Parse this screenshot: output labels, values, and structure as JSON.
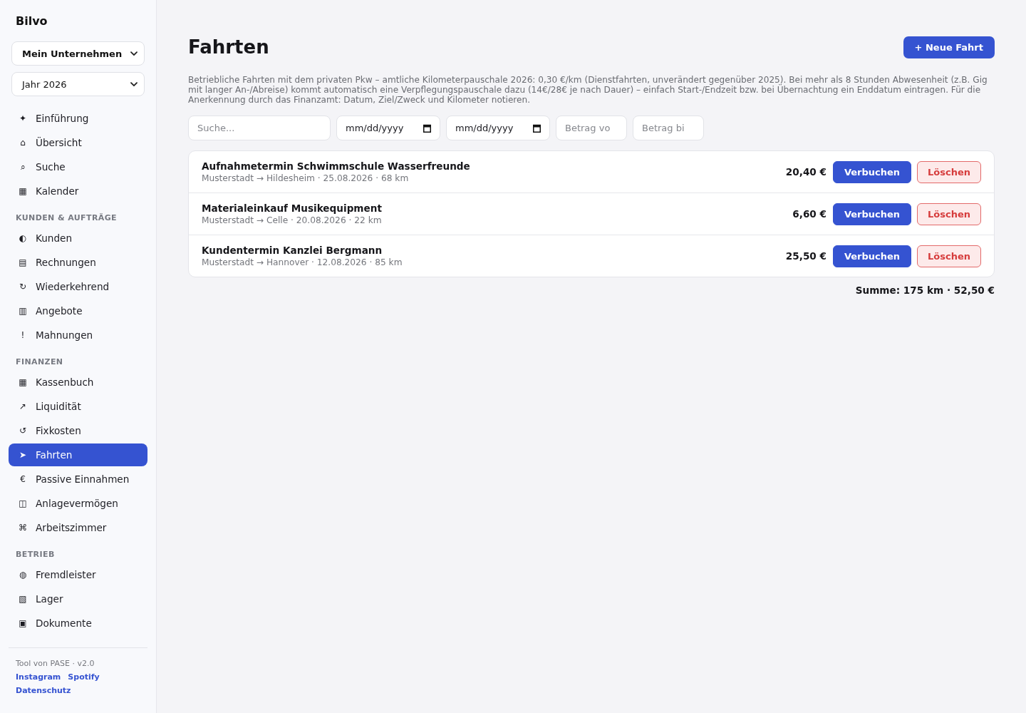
{
  "sidebar": {
    "brand": "Bilvo",
    "selects": [
      {
        "kind": "company",
        "value": "Mein Unternehmen"
      },
      {
        "kind": "year",
        "value": "Jahr 2026"
      }
    ],
    "groups": [
      {
        "items": [
          {
            "icon": "✦",
            "label": "Einführung",
            "selected": false
          },
          {
            "icon": "⌂",
            "label": "Übersicht",
            "selected": false
          },
          {
            "icon": "⌕",
            "label": "Suche",
            "selected": false
          },
          {
            "icon": "▦",
            "label": "Kalender",
            "selected": false
          }
        ]
      },
      {
        "heading": "KUNDEN & AUFTRÄGE",
        "items": [
          {
            "icon": "◐",
            "label": "Kunden",
            "selected": false
          },
          {
            "icon": "▤",
            "label": "Rechnungen",
            "selected": false
          },
          {
            "icon": "↻",
            "label": "Wiederkehrend",
            "selected": false
          },
          {
            "icon": "▥",
            "label": "Angebote",
            "selected": false
          },
          {
            "icon": "!",
            "label": "Mahnungen",
            "selected": false
          }
        ]
      },
      {
        "heading": "FINANZEN",
        "items": [
          {
            "icon": "▦",
            "label": "Kassenbuch",
            "selected": false
          },
          {
            "icon": "↗",
            "label": "Liquidität",
            "selected": false
          },
          {
            "icon": "↺",
            "label": "Fixkosten",
            "selected": false
          },
          {
            "icon": "➤",
            "label": "Fahrten",
            "selected": true
          },
          {
            "icon": "€",
            "label": "Passive Einnahmen",
            "selected": false
          },
          {
            "icon": "◫",
            "label": "Anlagevermögen",
            "selected": false
          },
          {
            "icon": "⌘",
            "label": "Arbeitszimmer",
            "selected": false
          }
        ]
      },
      {
        "heading": "BETRIEB",
        "items": [
          {
            "icon": "◍",
            "label": "Fremdleister",
            "selected": false
          },
          {
            "icon": "▧",
            "label": "Lager",
            "selected": false
          },
          {
            "icon": "▣",
            "label": "Dokumente",
            "selected": false
          }
        ]
      }
    ],
    "footer": {
      "credit": "Tool von PASE · v2.0",
      "links": [
        "Instagram",
        "Spotify",
        "Datenschutz"
      ]
    }
  },
  "page": {
    "title": "Fahrten",
    "new_button": "+ Neue Fahrt",
    "description": "Betriebliche Fahrten mit dem privaten Pkw – amtliche Kilometerpauschale 2026: 0,30 €/km (Dienstfahrten, unverändert gegenüber 2025). Bei mehr als 8 Stunden Abwesenheit (z.B. Gig mit langer An-/Abreise) kommt automatisch eine Verpflegungspauschale dazu (14€/28€ je nach Dauer) – einfach Start-/Endzeit bzw. bei Übernachtung ein Enddatum eintragen. Für die Anerkennung durch das Finanzamt: Datum, Ziel/Zweck und Kilometer notieren.",
    "filters": [
      {
        "kind": "search",
        "placeholder": "Suche..."
      },
      {
        "kind": "date",
        "placeholder": "mm/dd/yyyy"
      },
      {
        "kind": "date",
        "placeholder": "mm/dd/yyyy"
      },
      {
        "kind": "amount",
        "placeholder": "Betrag vo"
      },
      {
        "kind": "amount",
        "placeholder": "Betrag bi"
      }
    ]
  },
  "trips": [
    {
      "title": "Aufnahmetermin Schwimmschule Wasserfreunde",
      "details": "Musterstadt → Hildesheim · 25.08.2026 · 68 km",
      "amount": "20,40 €",
      "actions": [
        {
          "kind": "book",
          "label": "Verbuchen"
        },
        {
          "kind": "delete",
          "label": "Löschen"
        }
      ]
    },
    {
      "title": "Materialeinkauf Musikequipment",
      "details": "Musterstadt → Celle · 20.08.2026 · 22 km",
      "amount": "6,60 €",
      "actions": [
        {
          "kind": "book",
          "label": "Verbuchen"
        },
        {
          "kind": "delete",
          "label": "Löschen"
        }
      ]
    },
    {
      "title": "Kundentermin Kanzlei Bergmann",
      "details": "Musterstadt → Hannover · 12.08.2026 · 85 km",
      "amount": "25,50 €",
      "actions": [
        {
          "kind": "book",
          "label": "Verbuchen"
        },
        {
          "kind": "delete",
          "label": "Löschen"
        }
      ]
    }
  ],
  "total": "Summe: 175 km · 52,50 €"
}
